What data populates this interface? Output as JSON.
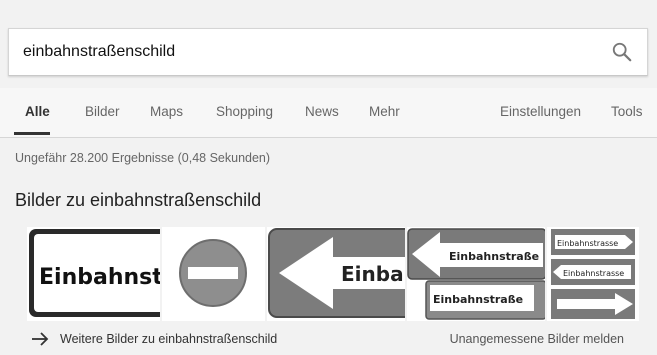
{
  "search": {
    "query": "einbahnstraßenschild"
  },
  "tabs": [
    {
      "label": "Alle",
      "active": true
    },
    {
      "label": "Bilder"
    },
    {
      "label": "Maps"
    },
    {
      "label": "Shopping"
    },
    {
      "label": "News"
    },
    {
      "label": "Mehr"
    }
  ],
  "settings_label": "Einstellungen",
  "tools_label": "Tools",
  "result_stats": "Ungefähr 28.200 Ergebnisse (0,48 Sekunden)",
  "images_heading": "Bilder zu einbahnstraßenschild",
  "image_texts": {
    "img1": "Einbahnstr",
    "img3": "Einbal",
    "img4_top": "Einbahnstraße",
    "img4_bottom": "Einbahnstraße",
    "img5_top": "Einbahnstrasse",
    "img5_mid": "Einbahnstrasse"
  },
  "more_images_link": "Weitere Bilder zu einbahnstraßenschild",
  "report_link": "Unangemessene Bilder melden"
}
